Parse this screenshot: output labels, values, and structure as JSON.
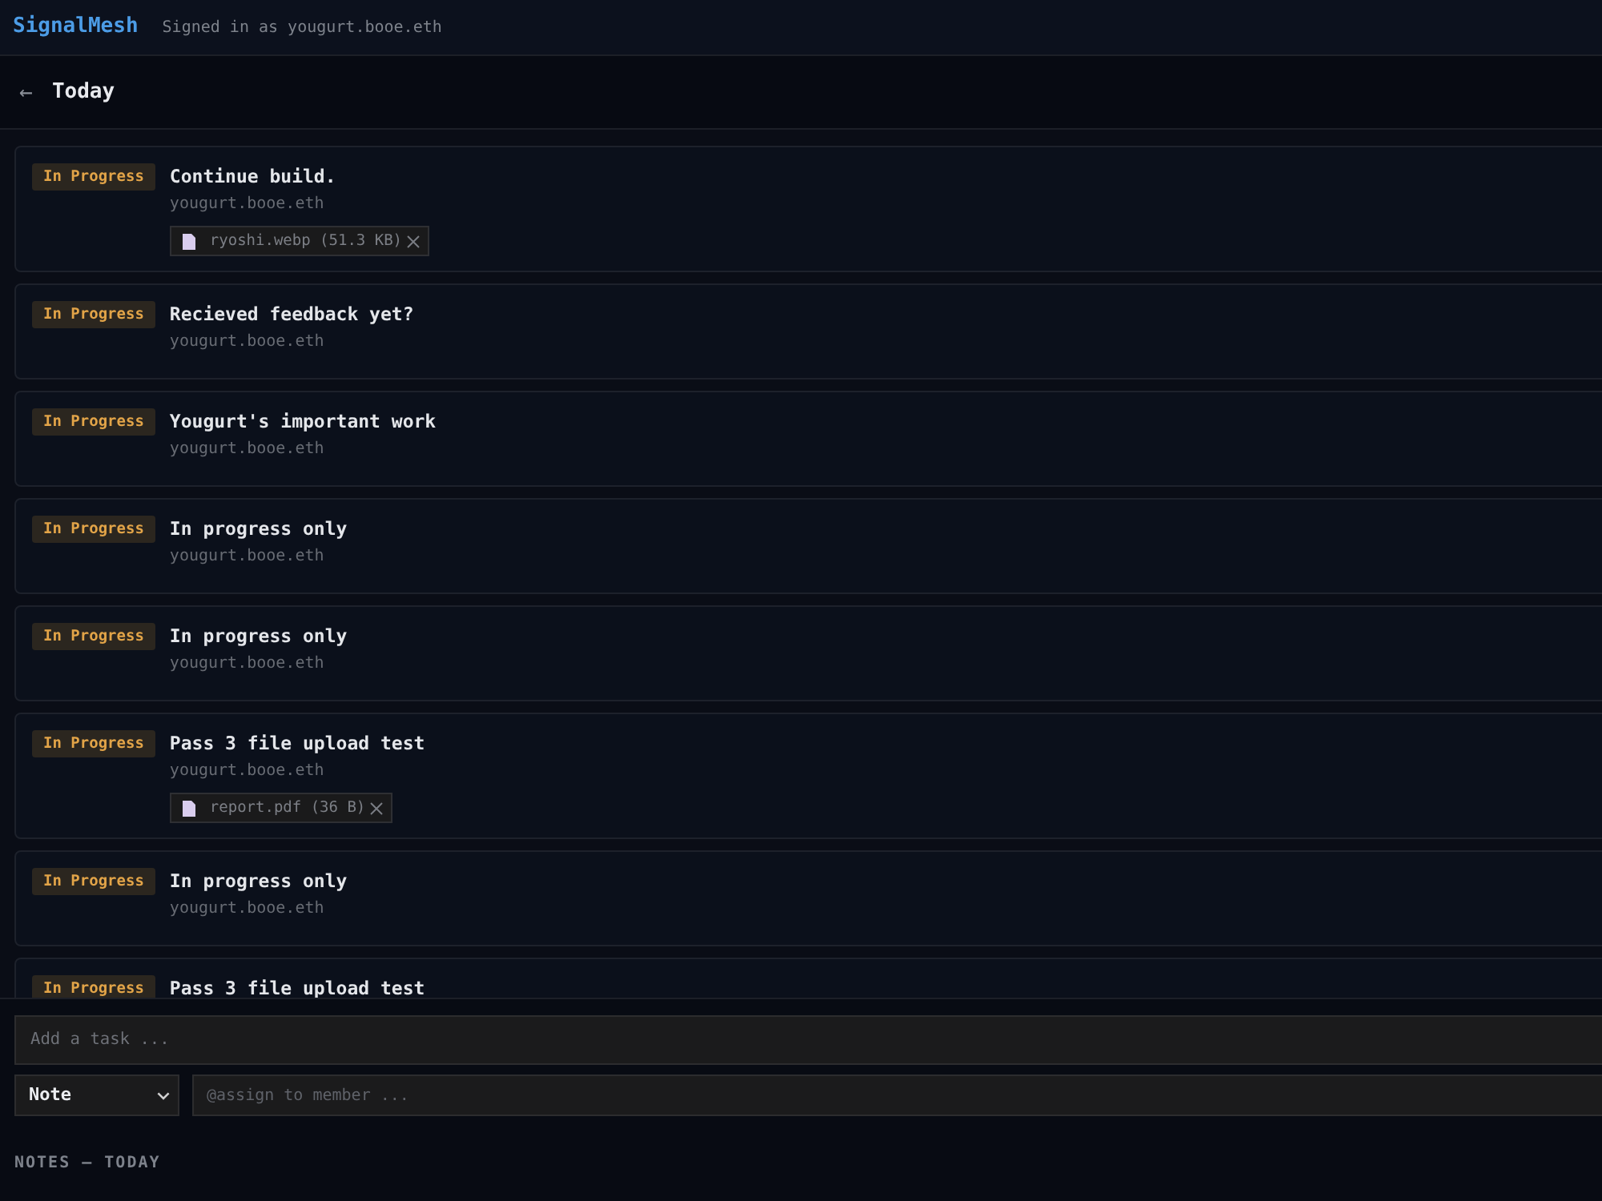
{
  "app": {
    "brand": "SignalMesh",
    "signed_in": "Signed in as yougurt.booe.eth"
  },
  "header": {
    "back": "←",
    "title": "Today"
  },
  "tasks": [
    {
      "status": "In Progress",
      "title": "Continue build.",
      "assignee": "yougurt.booe.eth",
      "attachments": [
        {
          "name": "ryoshi.webp (51.3 KB)"
        }
      ]
    },
    {
      "status": "In Progress",
      "title": "Recieved feedback yet?",
      "assignee": "yougurt.booe.eth"
    },
    {
      "status": "In Progress",
      "title": "Yougurt's important work",
      "assignee": "yougurt.booe.eth"
    },
    {
      "status": "In Progress",
      "title": "In progress only",
      "assignee": "yougurt.booe.eth"
    },
    {
      "status": "In Progress",
      "title": "In progress only",
      "assignee": "yougurt.booe.eth"
    },
    {
      "status": "In Progress",
      "title": "Pass 3 file upload test",
      "assignee": "yougurt.booe.eth",
      "attachments": [
        {
          "name": "report.pdf (36 B)"
        }
      ]
    },
    {
      "status": "In Progress",
      "title": "In progress only",
      "assignee": "yougurt.booe.eth"
    },
    {
      "status": "In Progress",
      "title": "Pass 3 file upload test"
    }
  ],
  "composer": {
    "task_placeholder": "Add a task ...",
    "type": "Note",
    "assign_placeholder": "@assign to member ..."
  },
  "notes": {
    "heading": "NOTES — TODAY"
  }
}
